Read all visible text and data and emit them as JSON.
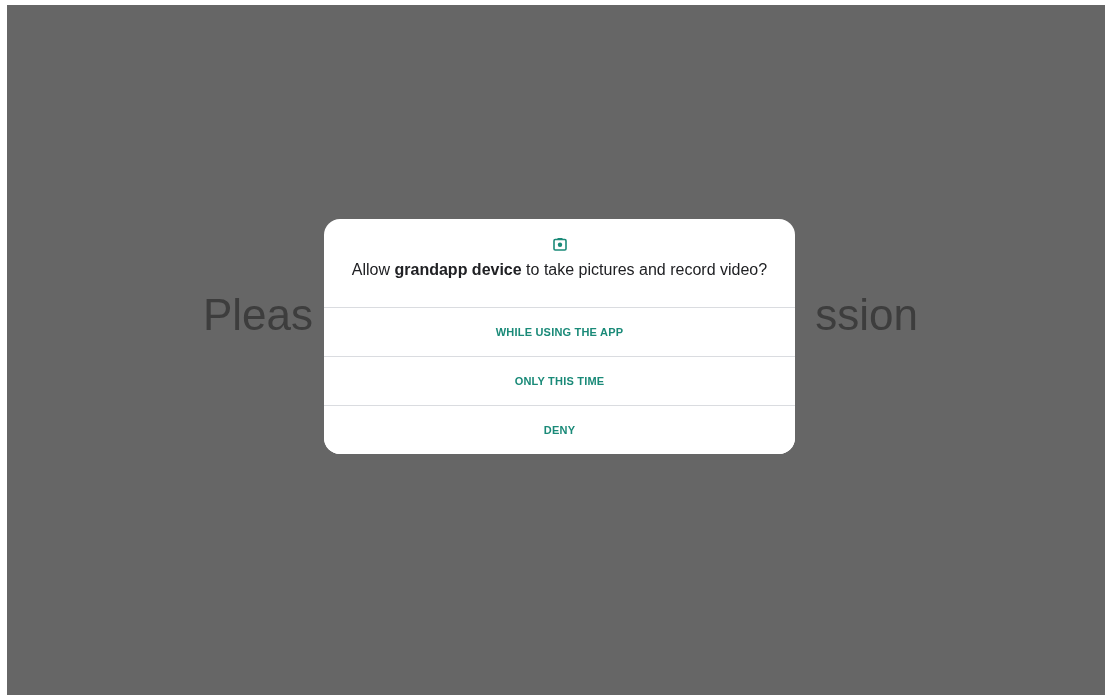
{
  "background_text": [
    "Pleas",
    "ssion"
  ],
  "dialog": {
    "title": "Allow **grandapp device** to take pictures and record video?",
    "buttons": [
      "WHILE USING THE APP",
      "ONLY THIS TIME",
      "DENY"
    ]
  }
}
